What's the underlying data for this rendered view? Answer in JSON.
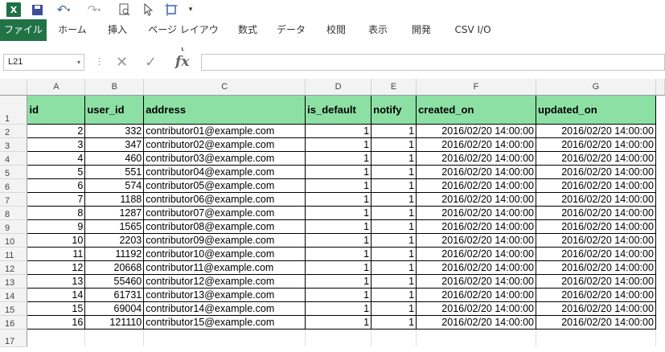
{
  "app": {
    "logo": "X"
  },
  "qat": {
    "undo": "↶",
    "redo": "↷",
    "dropdown": "▾",
    "more": "▾"
  },
  "tabs": [
    "ファイル",
    "ホーム",
    "挿入",
    "ページ レイアウト",
    "数式",
    "データ",
    "校閲",
    "表示",
    "開発",
    "CSV I/O"
  ],
  "formula_bar": {
    "name_box": "L21",
    "formula": "",
    "fx": "fx",
    "cancel": "✕",
    "enter": "✓"
  },
  "columns": [
    "A",
    "B",
    "C",
    "D",
    "E",
    "F",
    "G"
  ],
  "header_row": {
    "row": "1",
    "cells": [
      "id",
      "user_id",
      "address",
      "is_default",
      "notify",
      "created_on",
      "updated_on"
    ]
  },
  "rows": [
    {
      "row": "2",
      "cells": [
        "2",
        "332",
        "contributor01@example.com",
        "1",
        "1",
        "2016/02/20 14:00:00",
        "2016/02/20 14:00:00"
      ]
    },
    {
      "row": "3",
      "cells": [
        "3",
        "347",
        "contributor02@example.com",
        "1",
        "1",
        "2016/02/20 14:00:00",
        "2016/02/20 14:00:00"
      ]
    },
    {
      "row": "4",
      "cells": [
        "4",
        "460",
        "contributor03@example.com",
        "1",
        "1",
        "2016/02/20 14:00:00",
        "2016/02/20 14:00:00"
      ]
    },
    {
      "row": "5",
      "cells": [
        "5",
        "551",
        "contributor04@example.com",
        "1",
        "1",
        "2016/02/20 14:00:00",
        "2016/02/20 14:00:00"
      ]
    },
    {
      "row": "6",
      "cells": [
        "6",
        "574",
        "contributor05@example.com",
        "1",
        "1",
        "2016/02/20 14:00:00",
        "2016/02/20 14:00:00"
      ]
    },
    {
      "row": "7",
      "cells": [
        "7",
        "1188",
        "contributor06@example.com",
        "1",
        "1",
        "2016/02/20 14:00:00",
        "2016/02/20 14:00:00"
      ]
    },
    {
      "row": "8",
      "cells": [
        "8",
        "1287",
        "contributor07@example.com",
        "1",
        "1",
        "2016/02/20 14:00:00",
        "2016/02/20 14:00:00"
      ]
    },
    {
      "row": "9",
      "cells": [
        "9",
        "1565",
        "contributor08@example.com",
        "1",
        "1",
        "2016/02/20 14:00:00",
        "2016/02/20 14:00:00"
      ]
    },
    {
      "row": "10",
      "cells": [
        "10",
        "2203",
        "contributor09@example.com",
        "1",
        "1",
        "2016/02/20 14:00:00",
        "2016/02/20 14:00:00"
      ]
    },
    {
      "row": "11",
      "cells": [
        "11",
        "11192",
        "contributor10@example.com",
        "1",
        "1",
        "2016/02/20 14:00:00",
        "2016/02/20 14:00:00"
      ]
    },
    {
      "row": "12",
      "cells": [
        "12",
        "20668",
        "contributor11@example.com",
        "1",
        "1",
        "2016/02/20 14:00:00",
        "2016/02/20 14:00:00"
      ]
    },
    {
      "row": "13",
      "cells": [
        "13",
        "55460",
        "contributor12@example.com",
        "1",
        "1",
        "2016/02/20 14:00:00",
        "2016/02/20 14:00:00"
      ]
    },
    {
      "row": "14",
      "cells": [
        "14",
        "61731",
        "contributor13@example.com",
        "1",
        "1",
        "2016/02/20 14:00:00",
        "2016/02/20 14:00:00"
      ]
    },
    {
      "row": "15",
      "cells": [
        "15",
        "69004",
        "contributor14@example.com",
        "1",
        "1",
        "2016/02/20 14:00:00",
        "2016/02/20 14:00:00"
      ]
    },
    {
      "row": "16",
      "cells": [
        "16",
        "121110",
        "contributor15@example.com",
        "1",
        "1",
        "2016/02/20 14:00:00",
        "2016/02/20 14:00:00"
      ]
    }
  ],
  "empty_rows": [
    "17"
  ],
  "colors": {
    "file_tab": "#217346",
    "header_fill": "#8de0a4"
  }
}
